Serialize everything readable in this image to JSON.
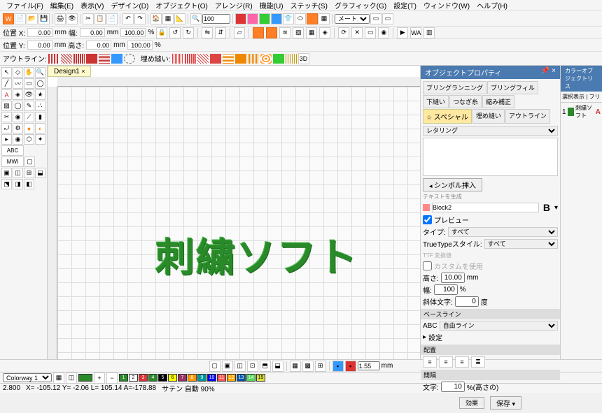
{
  "menu": [
    "ファイル(F)",
    "編集(E)",
    "表示(V)",
    "デザイン(D)",
    "オブジェクト(O)",
    "アレンジ(R)",
    "機能(U)",
    "ステッチ(S)",
    "グラフィック(G)",
    "設定(T)",
    "ウィンドウ(W)",
    "ヘルプ(H)"
  ],
  "zoom": "100",
  "coords": {
    "x_label": "位置 X:",
    "y_label": "位置 Y:",
    "x": "0.00",
    "y": "0.00",
    "x_mm": "mm",
    "y_mm": "mm",
    "w_label": "幅:",
    "h_label": "高さ:",
    "w": "0.00",
    "h": "0.00",
    "pw": "100.00",
    "ph": "100.00",
    "pct": "%"
  },
  "outline_label": "アウトライン:",
  "fill_label": "埋め縫い:",
  "tab_name": "Design1",
  "canvas_text": "刺繍ソフト",
  "tool_scale": "メートル系",
  "prop_panel": {
    "title": "オブジェクトプロパティ",
    "tabs": [
      "ブリングランニング",
      "ブリングフィル",
      "下縫い",
      "つなぎ糸",
      "縮み補正",
      "スペシャル",
      "埋め縫い",
      "アウトライン"
    ],
    "active_tab": "スペシャル",
    "type_label": "レタリング",
    "symbol_btn": "シンボル挿入",
    "gen_text": "テキストを生成",
    "font": "Block2",
    "bold": "B",
    "preview_chk": "プレビュー",
    "type_row": "タイプ:",
    "type_val": "すべて",
    "tt_row": "TrueTypeスタイル:",
    "tt_val": "すべて",
    "ttf_label": "TTF 変換値",
    "custom_chk": "カスタムを使用",
    "height_label": "高さ:",
    "height": "10.00",
    "height_u": "mm",
    "width_label": "幅:",
    "width": "100",
    "width_u": "%",
    "slant_label": "斜体文字:",
    "slant": "0",
    "slant_u": "度",
    "baseline_sec": "ベースライン",
    "baseline": "自由ライン",
    "settings": "設定",
    "align_sec": "配置",
    "spacing_sec": "間隔",
    "char_label": "文字:",
    "char": "10",
    "char_u": "%(高さの)",
    "apply": "効果",
    "save": "保存"
  },
  "color_panel": {
    "title": "カラーオブジェクトリス",
    "header": "選択表示 | フリ",
    "item_num": "1",
    "item_label": "刺繍ソフト",
    "item_color": "#2a8a2a"
  },
  "bottom_num": "1.55",
  "bottom_unit": "mm",
  "status": {
    "colorway_label": "Colorway 1",
    "palette": [
      {
        "n": "1",
        "c": "#2a8a2a"
      },
      {
        "n": "2",
        "c": "#fff"
      },
      {
        "n": "3",
        "c": "#d33"
      },
      {
        "n": "4",
        "c": "#2a8a2a"
      },
      {
        "n": "5",
        "c": "#000"
      },
      {
        "n": "6",
        "c": "#ff0"
      },
      {
        "n": "7",
        "c": "#936"
      },
      {
        "n": "8",
        "c": "#f90"
      },
      {
        "n": "9",
        "c": "#099"
      },
      {
        "n": "10",
        "c": "#00f"
      },
      {
        "n": "11",
        "c": "#f55"
      },
      {
        "n": "12",
        "c": "#fa0"
      },
      {
        "n": "13",
        "c": "#05a"
      },
      {
        "n": "14",
        "c": "#5d5"
      },
      {
        "n": "15",
        "c": "#dd4"
      }
    ],
    "zoom": "2.800",
    "pos": "X= -105.12 Y= -2.06 L= 105.14 A=-178.88",
    "stitch": "サテン 自動 90%"
  }
}
